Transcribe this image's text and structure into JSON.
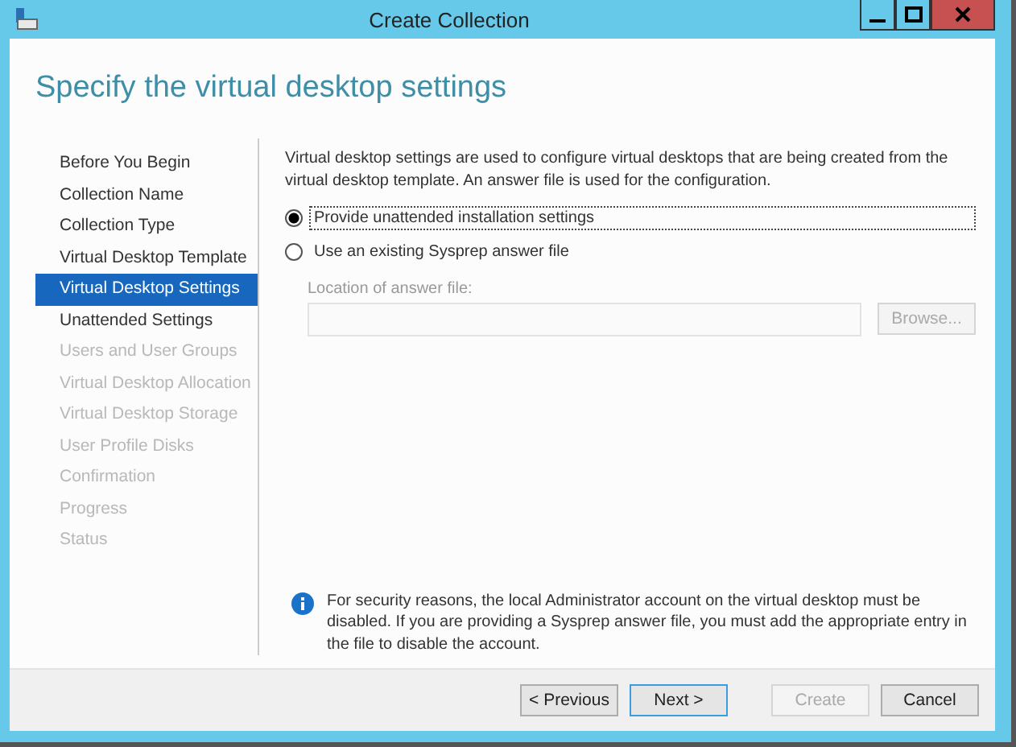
{
  "window": {
    "title": "Create Collection"
  },
  "heading": "Specify the virtual desktop settings",
  "sidebar": {
    "items": [
      {
        "label": "Before You Begin",
        "selected": false,
        "disabled": false
      },
      {
        "label": "Collection Name",
        "selected": false,
        "disabled": false
      },
      {
        "label": "Collection Type",
        "selected": false,
        "disabled": false
      },
      {
        "label": "Virtual Desktop Template",
        "selected": false,
        "disabled": false
      },
      {
        "label": "Virtual Desktop Settings",
        "selected": true,
        "disabled": false
      },
      {
        "label": "Unattended Settings",
        "selected": false,
        "disabled": false
      },
      {
        "label": "Users and User Groups",
        "selected": false,
        "disabled": true
      },
      {
        "label": "Virtual Desktop Allocation",
        "selected": false,
        "disabled": true
      },
      {
        "label": "Virtual Desktop Storage",
        "selected": false,
        "disabled": true
      },
      {
        "label": "User Profile Disks",
        "selected": false,
        "disabled": true
      },
      {
        "label": "Confirmation",
        "selected": false,
        "disabled": true
      },
      {
        "label": "Progress",
        "selected": false,
        "disabled": true
      },
      {
        "label": "Status",
        "selected": false,
        "disabled": true
      }
    ]
  },
  "description": "Virtual desktop settings are used to configure virtual desktops that are being created from the virtual desktop template. An answer file is used for the configuration.",
  "options": [
    {
      "label": "Provide unattended installation settings",
      "selected": true,
      "focused": true
    },
    {
      "label": "Use an existing Sysprep answer file",
      "selected": false,
      "focused": false
    }
  ],
  "answer_file": {
    "label": "Location of answer file:",
    "disabled": true,
    "browse": {
      "label": "Browse...",
      "disabled": true
    }
  },
  "note": "For security reasons, the local Administrator account on the virtual desktop must be disabled. If you are providing a Sysprep answer file, you must add the appropriate entry in the file to disable the account.",
  "buttons": [
    {
      "label": "< Previous",
      "disabled": false,
      "default": false
    },
    {
      "label": "Next >",
      "disabled": false,
      "default": true
    },
    {
      "label": "Create",
      "disabled": true,
      "default": false
    },
    {
      "label": "Cancel",
      "disabled": false,
      "default": false
    }
  ]
}
